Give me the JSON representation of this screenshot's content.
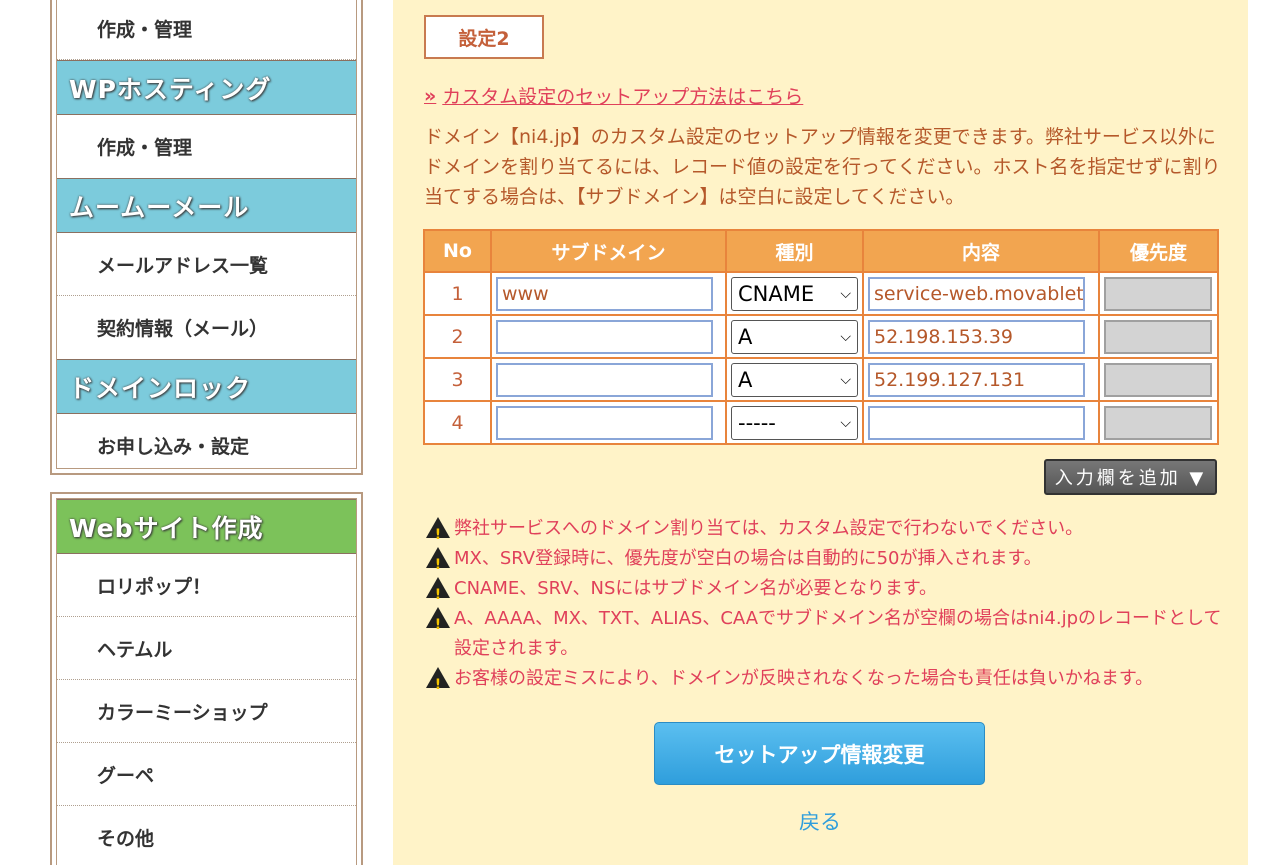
{
  "sidebar": {
    "box1": {
      "item_top": "作成・管理",
      "wp_head": "WPホスティング",
      "wp_item": "作成・管理",
      "mail_head": "ムームーメール",
      "mail_items": [
        "メールアドレス一覧",
        "契約情報（メール）"
      ],
      "lock_head": "ドメインロック",
      "lock_item": "お申し込み・設定"
    },
    "box2": {
      "web_head": "Webサイト作成",
      "web_items": [
        "ロリポップ！",
        "ヘテムル",
        "カラーミーショップ",
        "グーペ",
        "その他"
      ]
    }
  },
  "main": {
    "setting_label": "設定2",
    "setup_link_arrow": "»",
    "setup_link": "カスタム設定のセットアップ方法はこちら",
    "description": "ドメイン【ni4.jp】のカスタム設定のセットアップ情報を変更できます。弊社サービス以外にドメインを割り当てるには、レコード値の設定を行ってください。ホスト名を指定せずに割り当てする場合は、【サブドメイン】は空白に設定してください。",
    "table": {
      "headers": [
        "No",
        "サブドメイン",
        "種別",
        "内容",
        "優先度"
      ],
      "rows": [
        {
          "no": "1",
          "sub": "www",
          "type": "CNAME",
          "value": "service-web.movablet",
          "priority": ""
        },
        {
          "no": "2",
          "sub": "",
          "type": "A",
          "value": "52.198.153.39",
          "priority": ""
        },
        {
          "no": "3",
          "sub": "",
          "type": "A",
          "value": "52.199.127.131",
          "priority": ""
        },
        {
          "no": "4",
          "sub": "",
          "type": "-----",
          "value": "",
          "priority": ""
        }
      ]
    },
    "add_button": "入力欄を追加 ▼",
    "notes": [
      "弊社サービスへのドメイン割り当ては、カスタム設定で行わないでください。",
      "MX、SRV登録時に、優先度が空白の場合は自動的に50が挿入されます。",
      "CNAME、SRV、NSにはサブドメイン名が必要となります。",
      "A、AAAA、MX、TXT、ALIAS、CAAでサブドメイン名が空欄の場合はni4.jpのレコードとして設定されます。",
      "お客様の設定ミスにより、ドメインが反映されなくなった場合も責任は負いかねます。"
    ],
    "submit_button": "セットアップ情報変更",
    "back_link": "戻る"
  },
  "colors": {
    "nav_blue": "#7ccbdc",
    "nav_green": "#7cc25a",
    "panel_bg": "#fff3c8",
    "table_header": "#f2a550",
    "warning_text": "#e0405a",
    "submit_button": "#3aa8e4"
  }
}
